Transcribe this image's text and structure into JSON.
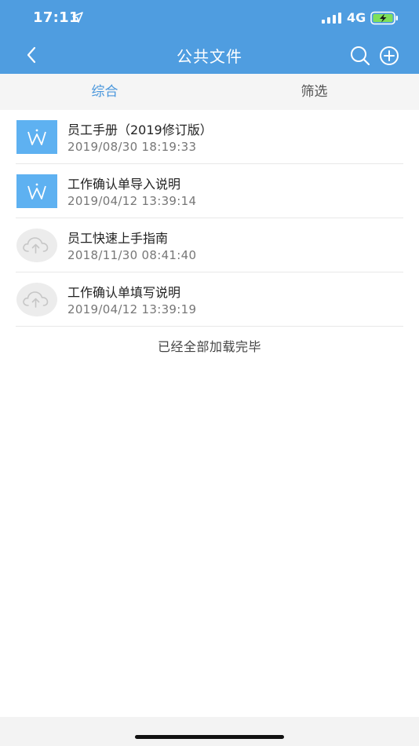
{
  "status_bar": {
    "time": "17:11",
    "network": "4G"
  },
  "nav": {
    "title": "公共文件"
  },
  "tabs": [
    {
      "label": "综合",
      "active": true
    },
    {
      "label": "筛选",
      "active": false
    }
  ],
  "files": [
    {
      "name": "员工手册（2019修订版）",
      "date": "2019/08/30 18:19:33",
      "icon": "word-doc-icon"
    },
    {
      "name": "工作确认单导入说明",
      "date": "2019/04/12 13:39:14",
      "icon": "word-doc-icon"
    },
    {
      "name": "员工快速上手指南",
      "date": "2018/11/30 08:41:40",
      "icon": "cloud-upload-icon"
    },
    {
      "name": "工作确认单填写说明",
      "date": "2019/04/12 13:39:19",
      "icon": "cloud-upload-icon"
    }
  ],
  "list_footer": "已经全部加载完毕",
  "colors": {
    "header": "#4f9de0",
    "active_tab": "#4a97dc",
    "word_icon": "#5eb1f1"
  }
}
